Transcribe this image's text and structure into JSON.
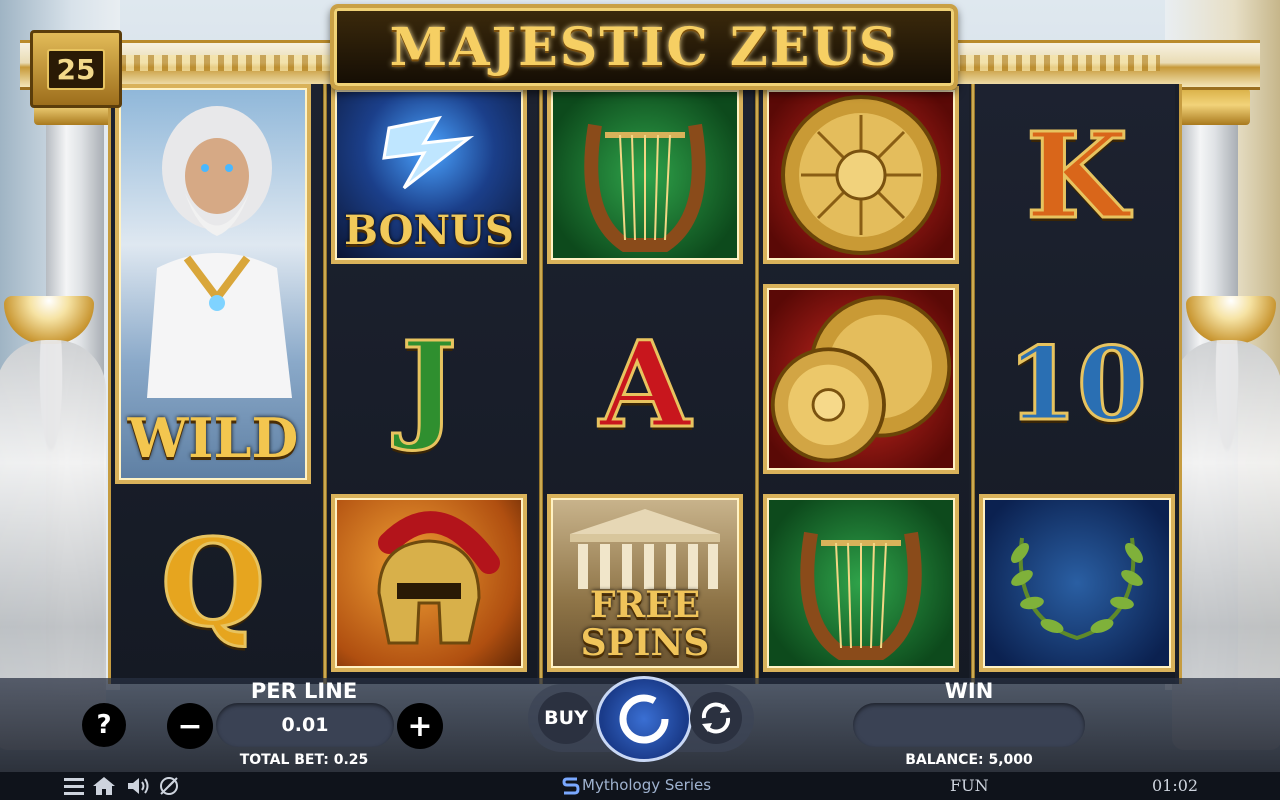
{
  "game": {
    "title": "MAJESTIC ZEUS",
    "lines": "25"
  },
  "reels": [
    [
      {
        "symbol": "zeus-wild",
        "label": "WILD"
      },
      {
        "symbol": "card-q",
        "label": "Q"
      }
    ],
    [
      {
        "symbol": "bonus-lightning",
        "label": "BONUS"
      },
      {
        "symbol": "card-j",
        "label": "J"
      },
      {
        "symbol": "spartan-helmet",
        "label": ""
      }
    ],
    [
      {
        "symbol": "lyre",
        "label": ""
      },
      {
        "symbol": "card-a",
        "label": "A"
      },
      {
        "symbol": "free-spins-temple",
        "label": "FREE SPINS"
      }
    ],
    [
      {
        "symbol": "shield",
        "label": ""
      },
      {
        "symbol": "double-shield",
        "label": ""
      },
      {
        "symbol": "lyre",
        "label": ""
      }
    ],
    [
      {
        "symbol": "card-k",
        "label": "K"
      },
      {
        "symbol": "card-10",
        "label": "10"
      },
      {
        "symbol": "laurel-wreath",
        "label": ""
      }
    ]
  ],
  "controls": {
    "help": "?",
    "per_line_label": "PER LINE",
    "per_line_value": "0.01",
    "minus": "−",
    "plus": "+",
    "total_bet": "TOTAL BET: 0.25",
    "buy": "BUY",
    "win_label": "WIN",
    "win_value": "",
    "balance": "BALANCE: 5,000"
  },
  "footer": {
    "series": "Mythology Series",
    "mode": "FUN",
    "clock": "01:02"
  },
  "colors": {
    "gold": "#e7c35f",
    "card_j": "#2f8f2f",
    "card_a": "#c8161d",
    "card_k": "#d9661a",
    "card_10": "#2a6fb3",
    "card_q": "#e6a51f"
  }
}
